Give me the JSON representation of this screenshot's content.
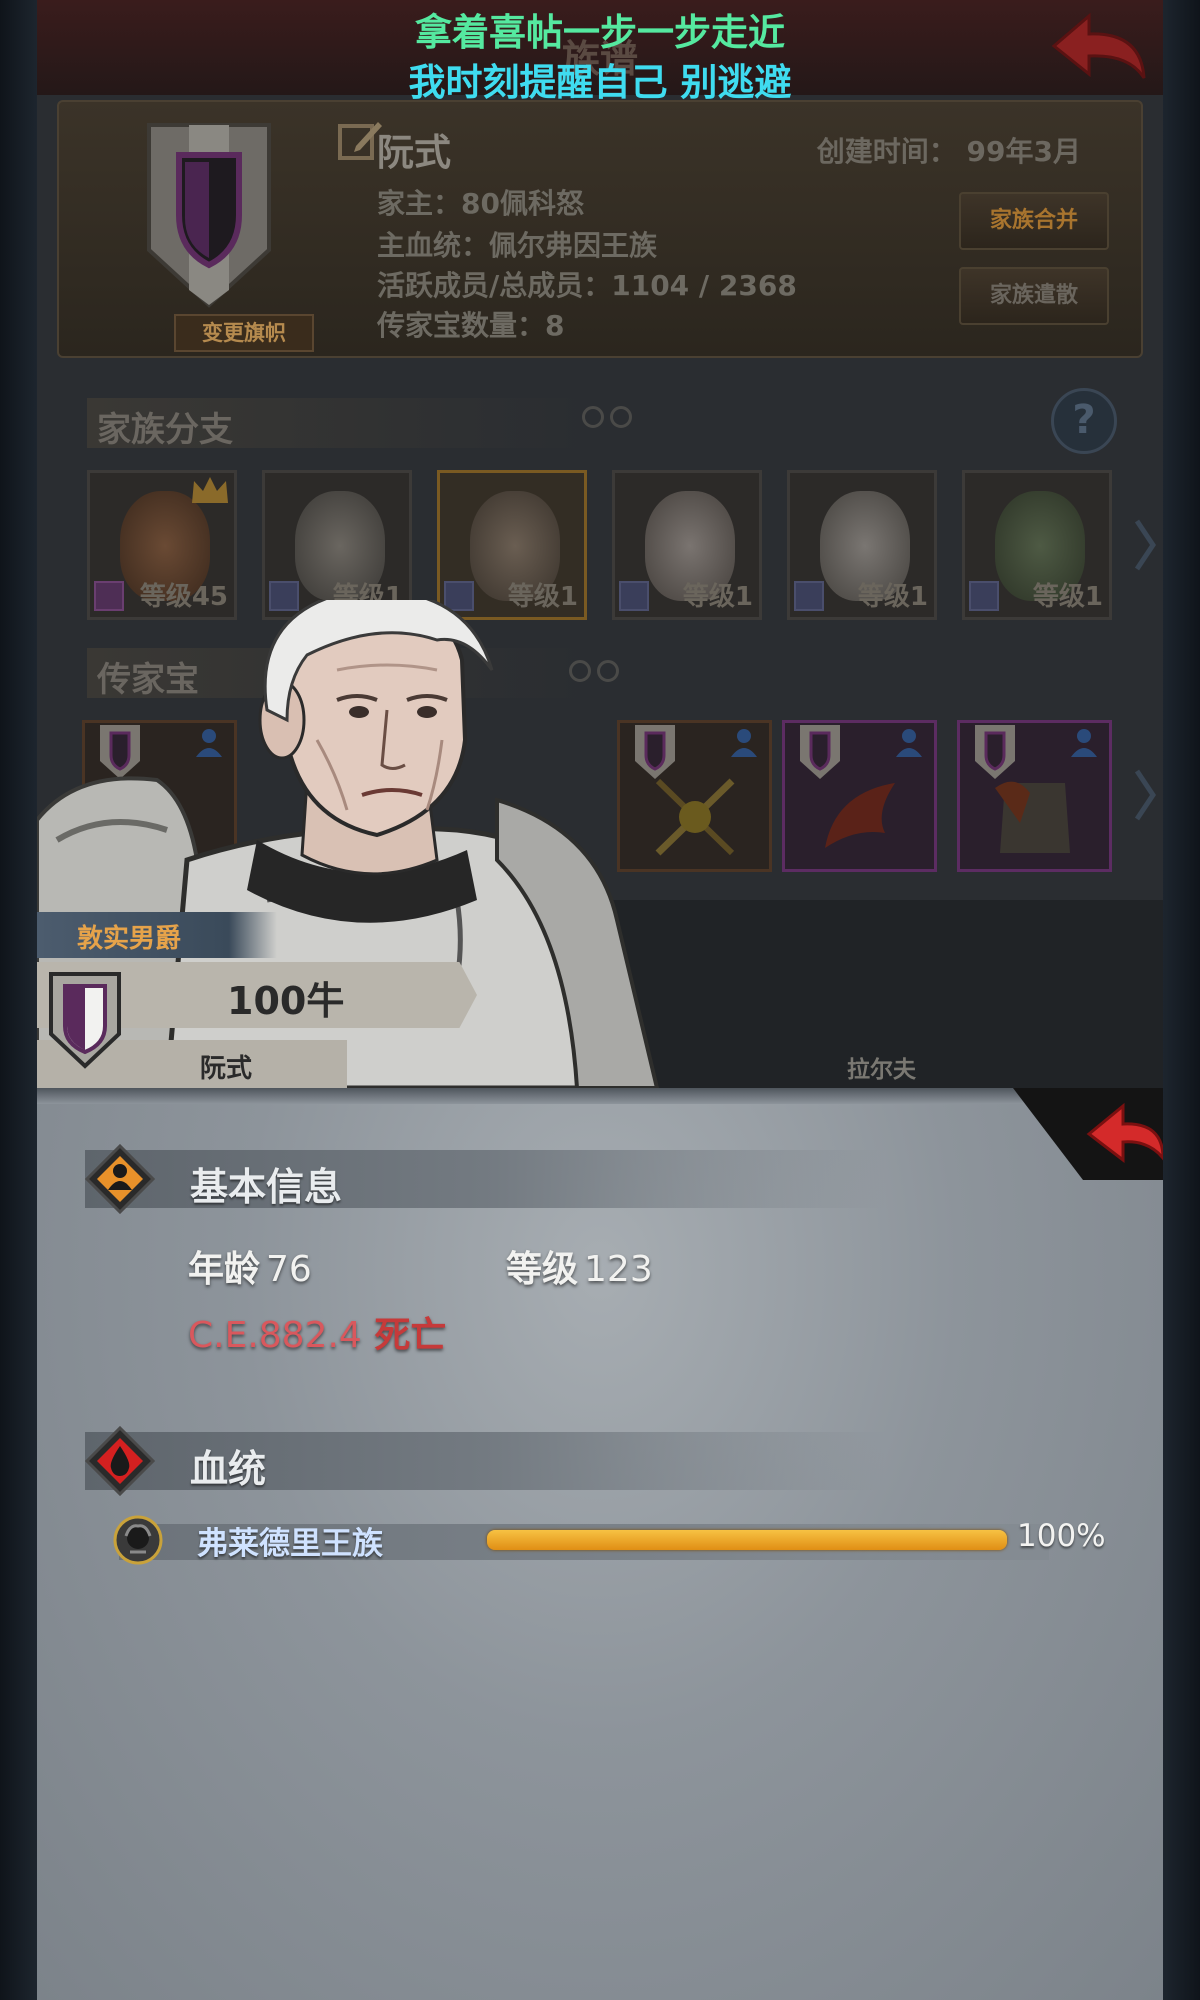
{
  "caption": {
    "line1": "拿着喜帖一步一步走近",
    "line2": "我时刻提醒自己 别逃避"
  },
  "header": {
    "title_ghost": "族谱"
  },
  "family": {
    "name": "阮式",
    "created_label": "创建时间：",
    "created_value": "99年3月",
    "head": "家主：80佩科怒",
    "main_bloodline": "主血统：佩尔弗因王族",
    "members": "活跃成员/总成员：1104 / 2368",
    "heirloom_count": "传家宝数量：8",
    "change_banner": "变更旗帜",
    "merge_button": "家族合并",
    "dissolve_button": "家族遣散"
  },
  "branches": {
    "title": "家族分支",
    "items": [
      {
        "level": "等级45"
      },
      {
        "level": "等级1"
      },
      {
        "level": "等级1"
      },
      {
        "level": "等级1"
      },
      {
        "level": "等级1"
      },
      {
        "level": "等级1"
      }
    ]
  },
  "heirlooms": {
    "title": "传家宝"
  },
  "character": {
    "title": "敦实男爵",
    "power": "100牛",
    "family": "阮式",
    "other_name": "拉尔夫"
  },
  "basic_info": {
    "heading": "基本信息",
    "age_label": "年龄",
    "age_value": "76",
    "level_label": "等级",
    "level_value": "123",
    "date": "C.E.882.4",
    "status": "死亡"
  },
  "bloodline": {
    "heading": "血统",
    "name": "弗莱德里王族",
    "percent_text": "100%",
    "fraction": 1.0
  },
  "colors": {
    "status_red": "#c63a3a",
    "date_red": "#d9585d",
    "accent_orange": "#e8912a",
    "caption_green": "#55e9a0",
    "caption_cyan": "#3fdcf0"
  }
}
